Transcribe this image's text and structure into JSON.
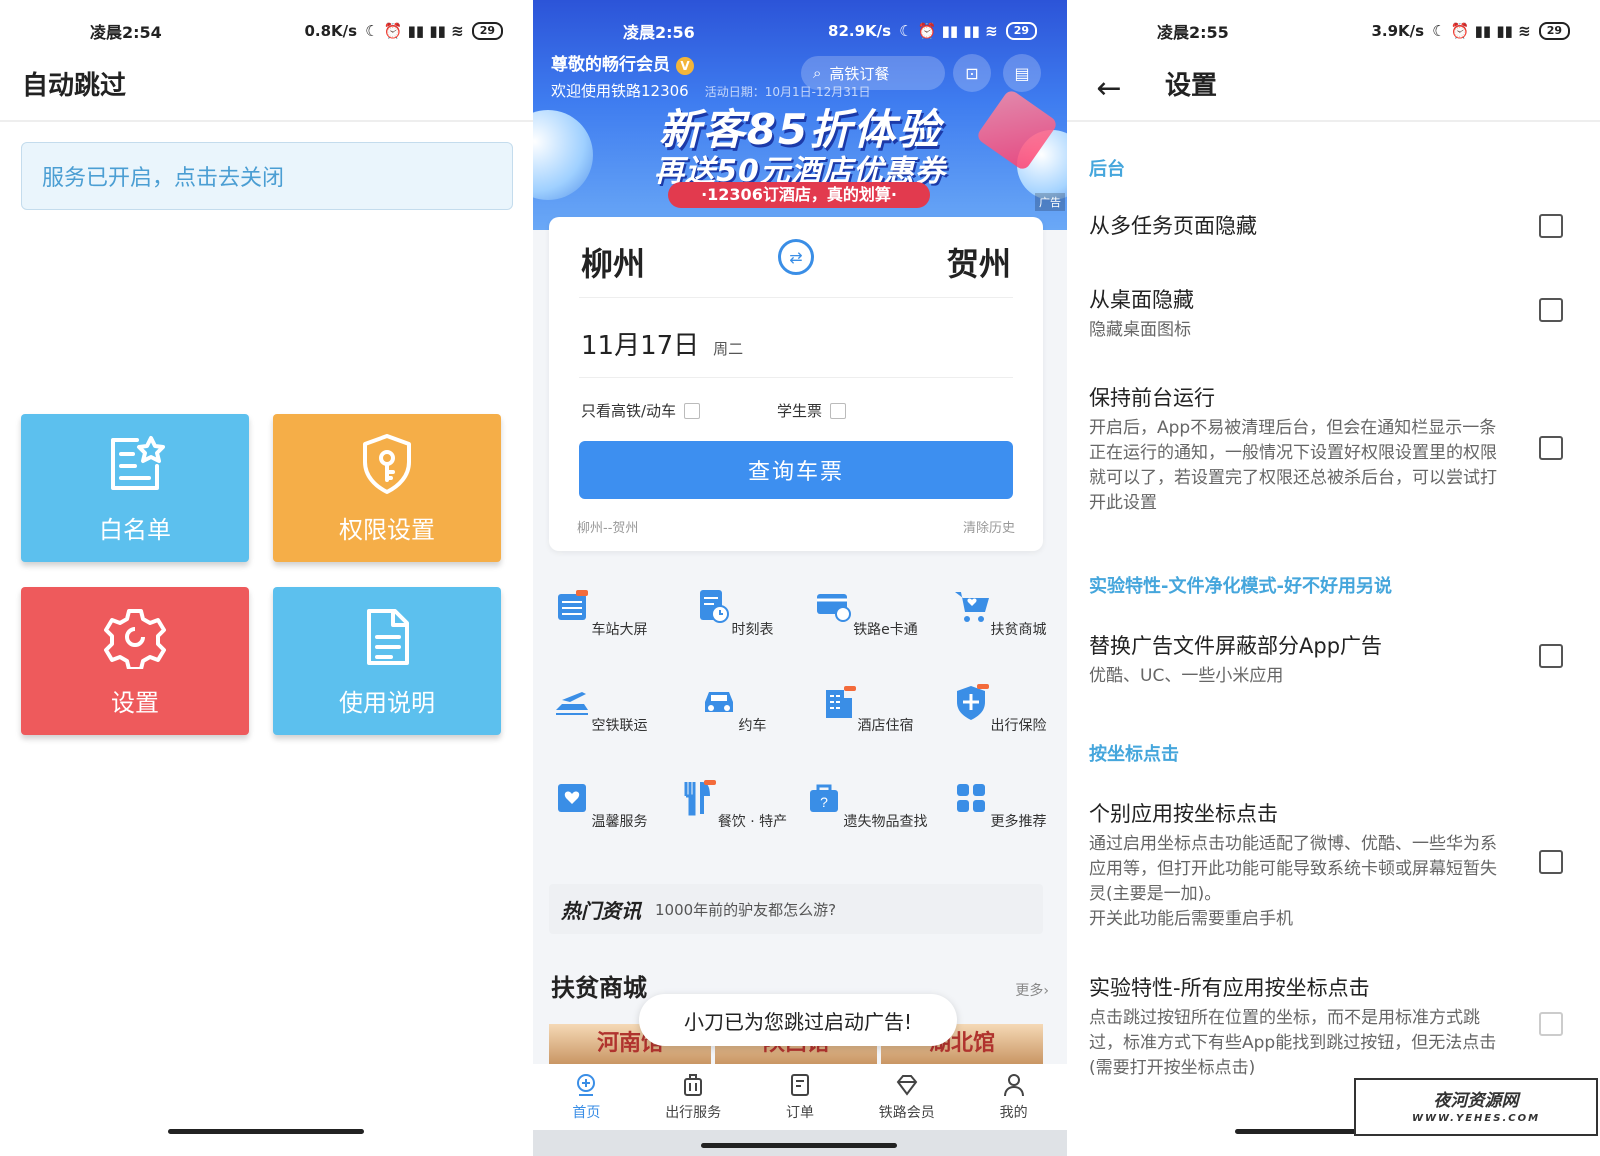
{
  "panel1": {
    "status": {
      "time": "凌晨2:54",
      "speed": "0.8K/s",
      "battery": "29"
    },
    "title": "自动跳过",
    "service_button": "服务已开启，点击去关闭",
    "tiles": [
      {
        "label": "白名单",
        "color": "#5cc0ee",
        "icon": "whitelist-icon"
      },
      {
        "label": "权限设置",
        "color": "#f5ae48",
        "icon": "shield-key-icon"
      },
      {
        "label": "设置",
        "color": "#ee5a5c",
        "icon": "gear-icon"
      },
      {
        "label": "使用说明",
        "color": "#5cc0ee",
        "icon": "document-icon"
      }
    ]
  },
  "panel2": {
    "status": {
      "time": "凌晨2:56",
      "speed": "82.9K/s",
      "battery": "29"
    },
    "vip": "尊敬的畅行会员",
    "welcome": "欢迎使用铁路12306",
    "activity_date": "活动日期：10月1日-12月31日",
    "search_placeholder": "高铁订餐",
    "banner_headline": "新客85折体验",
    "banner_sub": "再送50元酒店优惠券",
    "banner_tag": "·12306订酒店，真的划算·",
    "ad_tag": "广告",
    "from_city": "柳州",
    "to_city": "贺州",
    "date": "11月17日",
    "weekday": "周二",
    "option_gaotie": "只看高铁/动车",
    "option_student": "学生票",
    "query_button": "查询车票",
    "history": "柳州--贺州",
    "clear_history": "清除历史",
    "grid": [
      {
        "label": "车站大屏",
        "icon": "station-screen-icon"
      },
      {
        "label": "时刻表",
        "icon": "timetable-icon"
      },
      {
        "label": "铁路e卡通",
        "icon": "ecard-icon"
      },
      {
        "label": "扶贫商城",
        "icon": "cart-icon"
      },
      {
        "label": "空铁联运",
        "icon": "plane-train-icon"
      },
      {
        "label": "约车",
        "icon": "car-icon"
      },
      {
        "label": "酒店住宿",
        "icon": "hotel-icon"
      },
      {
        "label": "出行保险",
        "icon": "insurance-icon"
      },
      {
        "label": "温馨服务",
        "icon": "heart-service-icon"
      },
      {
        "label": "餐饮 · 特产",
        "icon": "dining-icon"
      },
      {
        "label": "遗失物品查找",
        "icon": "lost-found-icon"
      },
      {
        "label": "更多推荐",
        "icon": "more-apps-icon"
      }
    ],
    "news_title": "热门资讯",
    "news_text": "1000年前的驴友都怎么游?",
    "mall_title": "扶贫商城",
    "mall_more": "更多",
    "mall_items": [
      "河南馆",
      "陕西馆",
      "湖北馆"
    ],
    "toast": "小刀已为您跳过启动广告!",
    "tabs": [
      "首页",
      "出行服务",
      "订单",
      "铁路会员",
      "我的"
    ]
  },
  "panel3": {
    "status": {
      "time": "凌晨2:55",
      "speed": "3.9K/s",
      "battery": "29"
    },
    "title": "设置",
    "sections": {
      "bg": "后台",
      "exp": "实验特性-文件净化模式-好不好用另说",
      "coord": "按坐标点击"
    },
    "rows": [
      {
        "title": "从多任务页面隐藏",
        "desc": ""
      },
      {
        "title": "从桌面隐藏",
        "desc": "隐藏桌面图标"
      },
      {
        "title": "保持前台运行",
        "desc": "开启后，App不易被清理后台，但会在通知栏显示一条正在运行的通知，一般情况下设置好权限设置里的权限就可以了，若设置完了权限还总被杀后台，可以尝试打开此设置"
      },
      {
        "title": "替换广告文件屏蔽部分App广告",
        "desc": "优酷、UC、一些小米应用"
      },
      {
        "title": "个别应用按坐标点击",
        "desc": "通过启用坐标点击功能适配了微博、优酷、一些华为系应用等，但打开此功能可能导致系统卡顿或屏幕短暂失灵(主要是一加)。\n开关此功能后需要重启手机"
      },
      {
        "title": "实验特性-所有应用按坐标点击",
        "desc": "点击跳过按钮所在位置的坐标，而不是用标准方式跳过，标准方式下有些App能找到跳过按钮，但无法点击(需要打开按坐标点击)"
      }
    ],
    "watermark": "夜河资源网",
    "watermark_url": "WWW.YEHES.COM"
  }
}
